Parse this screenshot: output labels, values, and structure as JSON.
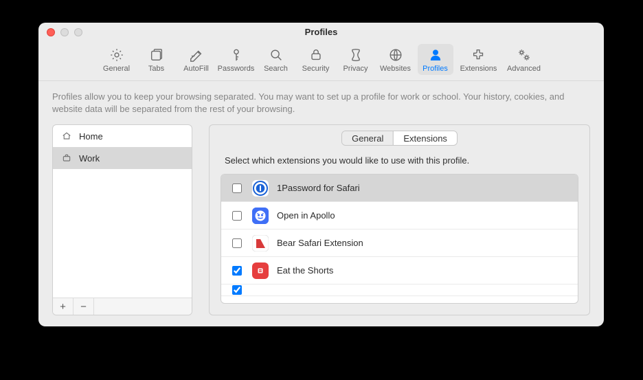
{
  "window_title": "Profiles",
  "traffic": {
    "close": "close-button",
    "min": "minimize-button",
    "zoom": "zoom-button"
  },
  "toolbar": [
    {
      "key": "general",
      "label": "General"
    },
    {
      "key": "tabs",
      "label": "Tabs"
    },
    {
      "key": "autofill",
      "label": "AutoFill"
    },
    {
      "key": "passwords",
      "label": "Passwords"
    },
    {
      "key": "search",
      "label": "Search"
    },
    {
      "key": "security",
      "label": "Security"
    },
    {
      "key": "privacy",
      "label": "Privacy"
    },
    {
      "key": "websites",
      "label": "Websites"
    },
    {
      "key": "profiles",
      "label": "Profiles",
      "active": true
    },
    {
      "key": "extensions",
      "label": "Extensions"
    },
    {
      "key": "advanced",
      "label": "Advanced"
    }
  ],
  "description": "Profiles allow you to keep your browsing separated. You may want to set up a profile for work or school. Your history, cookies, and website data will be separated from the rest of your browsing.",
  "profiles": [
    {
      "name": "Home",
      "icon": "house",
      "selected": false
    },
    {
      "name": "Work",
      "icon": "briefcase",
      "selected": true
    }
  ],
  "footer": {
    "add": "+",
    "remove": "−"
  },
  "segments": [
    {
      "key": "general",
      "label": "General",
      "active": false
    },
    {
      "key": "extensions",
      "label": "Extensions",
      "active": true
    }
  ],
  "detail_instruction": "Select which extensions you would like to use with this profile.",
  "extensions": [
    {
      "name": "1Password for Safari",
      "checked": false,
      "selected": true,
      "icon_bg": "#ffffff",
      "icon_fg": "#1a62d6",
      "icon": "onepassword"
    },
    {
      "name": "Open in Apollo",
      "checked": false,
      "selected": false,
      "icon_bg": "#3f6ff6",
      "icon_fg": "#ffffff",
      "icon": "apollo"
    },
    {
      "name": "Bear Safari Extension",
      "checked": false,
      "selected": false,
      "icon_bg": "#ffffff",
      "icon_fg": "#d83a3a",
      "icon": "bear"
    },
    {
      "name": "Eat the Shorts",
      "checked": true,
      "selected": false,
      "icon_bg": "#e63e3e",
      "icon_fg": "#ffffff",
      "icon": "shorts"
    }
  ]
}
